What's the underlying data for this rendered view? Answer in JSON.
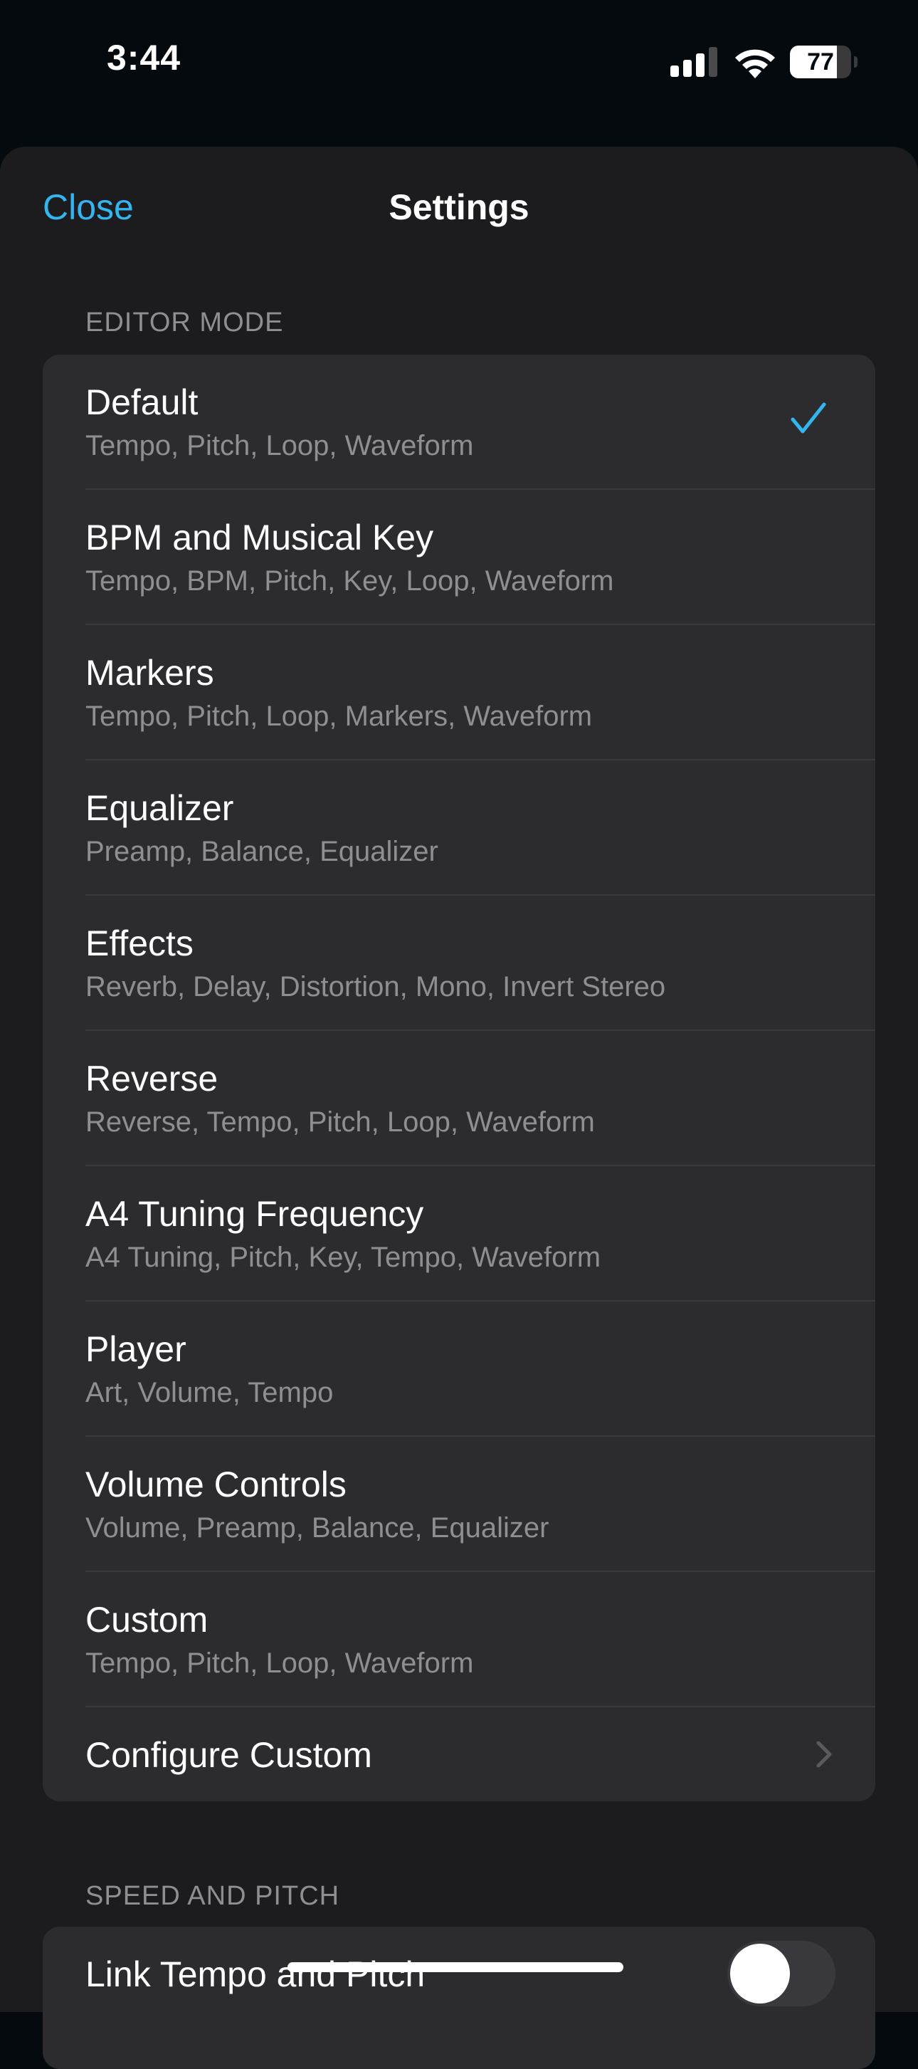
{
  "status_bar": {
    "time": "3:44",
    "battery_percent": "77",
    "battery_level": 0.77,
    "signal_bars_active": 3,
    "signal_bars_total": 4
  },
  "header": {
    "close_label": "Close",
    "title": "Settings"
  },
  "colors": {
    "accent": "#35b5f0",
    "sheet_background": "#1c1c1e",
    "group_background": "#2c2c2e",
    "secondary_text": "#8e8e93"
  },
  "editor_mode": {
    "header": "EDITOR MODE",
    "selected": "Default",
    "items": [
      {
        "title": "Default",
        "subtitle": "Tempo, Pitch, Loop, Waveform"
      },
      {
        "title": "BPM and Musical Key",
        "subtitle": "Tempo, BPM, Pitch, Key, Loop, Waveform"
      },
      {
        "title": "Markers",
        "subtitle": "Tempo, Pitch, Loop, Markers, Waveform"
      },
      {
        "title": "Equalizer",
        "subtitle": "Preamp, Balance, Equalizer"
      },
      {
        "title": "Effects",
        "subtitle": "Reverb, Delay, Distortion, Mono, Invert Stereo"
      },
      {
        "title": "Reverse",
        "subtitle": "Reverse, Tempo, Pitch, Loop, Waveform"
      },
      {
        "title": "A4 Tuning Frequency",
        "subtitle": "A4 Tuning, Pitch, Key, Tempo, Waveform"
      },
      {
        "title": "Player",
        "subtitle": "Art, Volume, Tempo"
      },
      {
        "title": "Volume Controls",
        "subtitle": "Volume, Preamp, Balance, Equalizer"
      },
      {
        "title": "Custom",
        "subtitle": "Tempo, Pitch, Loop, Waveform"
      }
    ],
    "configure_label": "Configure Custom"
  },
  "speed_and_pitch": {
    "header": "SPEED AND PITCH",
    "link_tempo_label": "Link Tempo and Pitch",
    "link_tempo_on": false
  }
}
